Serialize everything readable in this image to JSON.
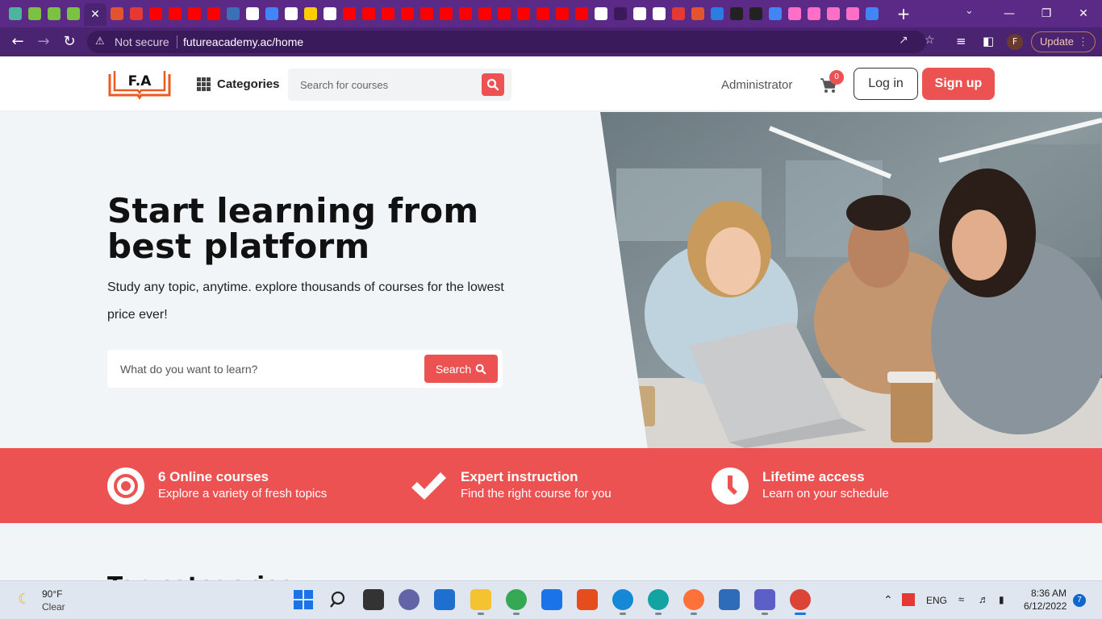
{
  "browser": {
    "url_security": "Not secure",
    "url": "futureacademy.ac/home",
    "update_label": "Update",
    "profile_initial": "F",
    "tab_icon_colors": [
      "#4fb3a2",
      "#7cc242",
      "#7cc242",
      "#7cc242",
      "#e2542f",
      "#e53935",
      "#ff0000",
      "#ff0000",
      "#ff0000",
      "#ff0000",
      "#3b6fb6",
      "#ffffff",
      "#4285f4",
      "#ffffff",
      "#ffcc00",
      "#ffffff",
      "#ff0000",
      "#ff0000",
      "#ff0000",
      "#ff0000",
      "#ff0000",
      "#ff0000",
      "#ff0000",
      "#ff0000",
      "#ff0000",
      "#ff0000",
      "#ff0000",
      "#ff0000",
      "#ff0000",
      "#ffffff",
      "#3a1a5a",
      "#ffffff",
      "#ffffff",
      "#e53935",
      "#e2542f",
      "#2a7de1",
      "#222222",
      "#222222",
      "#4285f4",
      "#ff6ec7",
      "#ff6ec7",
      "#ff6ec7",
      "#ff6ec7",
      "#4285f4"
    ]
  },
  "header": {
    "logo_text": "F.A",
    "categories_label": "Categories",
    "search_placeholder": "Search for courses",
    "admin_label": "Administrator",
    "cart_count": "0",
    "login_label": "Log in",
    "signup_label": "Sign up"
  },
  "hero": {
    "title": "Start learning from best platform",
    "subtitle": "Study any topic, anytime. explore thousands of courses for the lowest price ever!",
    "search_placeholder": "What do you want to learn?",
    "search_button": "Search"
  },
  "features": [
    {
      "title": "6 Online courses",
      "desc": "Explore a variety of fresh topics",
      "icon": "target-icon"
    },
    {
      "title": "Expert instruction",
      "desc": "Find the right course for you",
      "icon": "check-icon"
    },
    {
      "title": "Lifetime access",
      "desc": "Learn on your schedule",
      "icon": "clock-icon"
    }
  ],
  "section_heading_partial": "Top categories",
  "taskbar": {
    "weather_temp": "90°F",
    "weather_cond": "Clear",
    "language": "ENG",
    "time": "8:36 AM",
    "date": "6/12/2022",
    "notifications": "7"
  },
  "colors": {
    "brand_accent": "#ec5252",
    "browser_frame": "#5b2a86"
  }
}
